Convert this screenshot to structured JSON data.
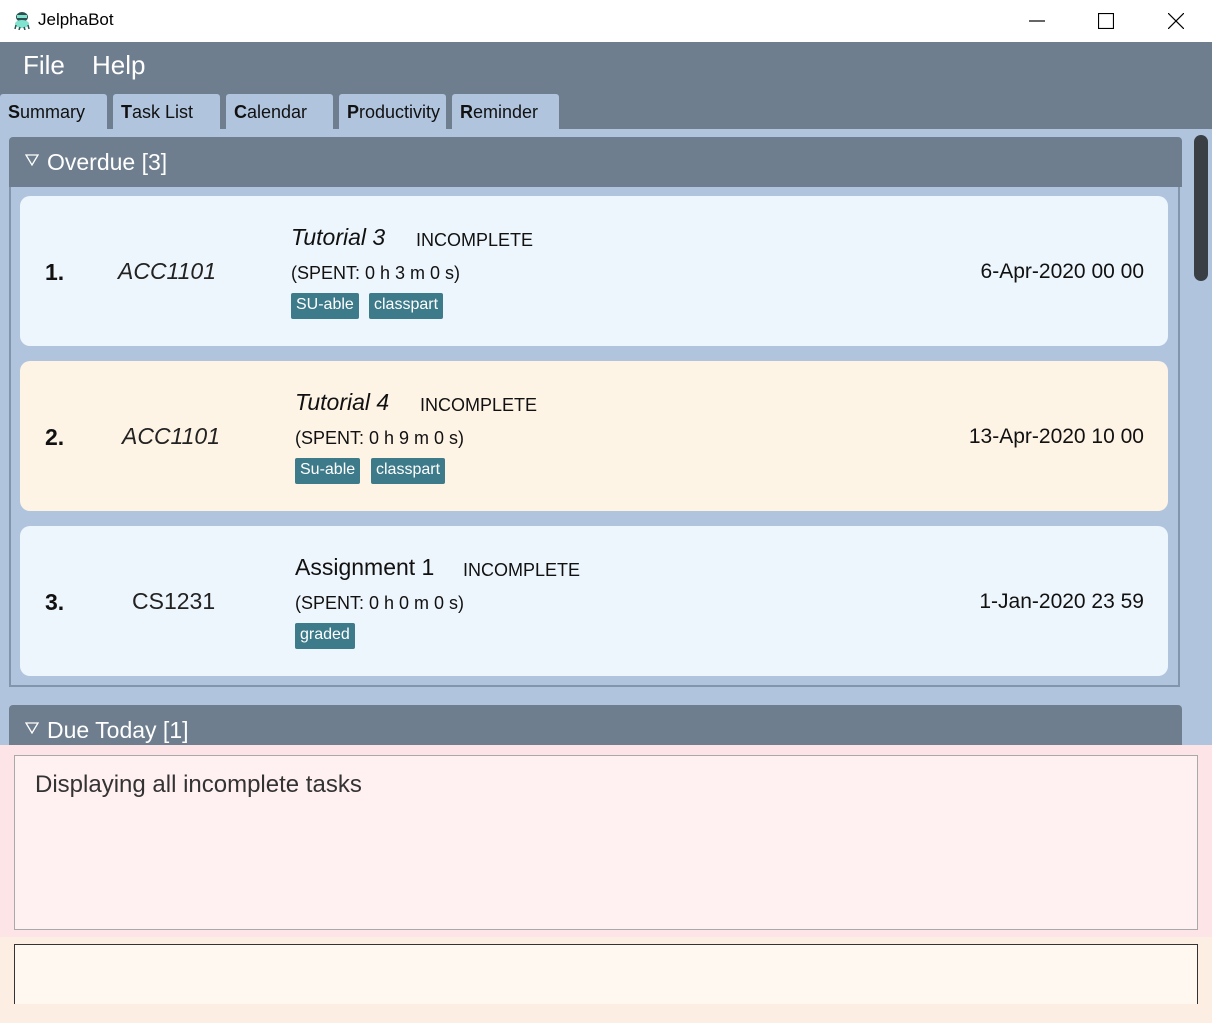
{
  "window": {
    "title": "JelphaBot"
  },
  "menu": {
    "file": "File",
    "help": "Help"
  },
  "tabs": [
    {
      "mnemonic": "S",
      "rest": "ummary"
    },
    {
      "mnemonic": "T",
      "rest": "ask List"
    },
    {
      "mnemonic": "C",
      "rest": "alendar"
    },
    {
      "mnemonic": "P",
      "rest": "roductivity"
    },
    {
      "mnemonic": "R",
      "rest": "eminder"
    }
  ],
  "groups": {
    "overdue": "Overdue [3]",
    "due_today": "Due Today [1]"
  },
  "tasks": [
    {
      "index": "1.",
      "module": "ACC1101",
      "name": "Tutorial 3",
      "status": "INCOMPLETE",
      "spent": "(SPENT: 0 h 3 m 0 s)",
      "tags": [
        "SU-able",
        "classpart"
      ],
      "date": "6-Apr-2020 00 00"
    },
    {
      "index": "2.",
      "module": "ACC1101",
      "name": "Tutorial 4",
      "status": "INCOMPLETE",
      "spent": "(SPENT: 0 h 9 m 0 s)",
      "tags": [
        "Su-able",
        "classpart"
      ],
      "date": "13-Apr-2020 10 00"
    },
    {
      "index": "3.",
      "module": "CS1231",
      "name": "Assignment 1",
      "status": "INCOMPLETE",
      "spent": "(SPENT: 0 h 0 m 0 s)",
      "tags": [
        "graded"
      ],
      "date": "1-Jan-2020 23 59"
    }
  ],
  "result": {
    "message": "Displaying all incomplete tasks"
  },
  "command": {
    "value": ""
  },
  "colors": {
    "header": "#6e7e8e",
    "tab": "#b0c4de",
    "tag": "#3d7a8a",
    "card_blue": "#eef6fd",
    "card_cream": "#fdf4e6"
  }
}
